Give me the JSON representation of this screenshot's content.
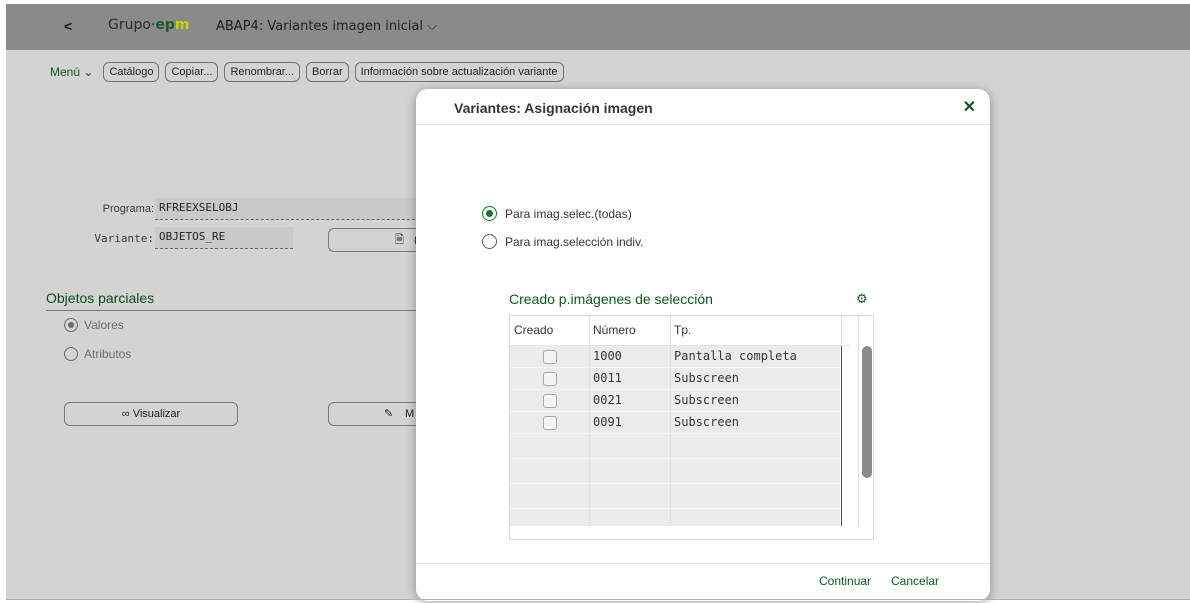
{
  "shell": {
    "back_icon": "chevron-left-icon",
    "logo_prefix": "Grupo·",
    "logo_brand_e": "ep",
    "logo_brand_m": "m",
    "title": "ABAP4: Variantes imagen inicial",
    "title_chevron": "chevron-down-icon"
  },
  "toolbar": {
    "menu": "Menú",
    "buttons": [
      "Catálogo",
      "Copiar...",
      "Renombrar...",
      "Borrar",
      "Información sobre actualización variante"
    ]
  },
  "form": {
    "programa_label": "Programa:",
    "programa_value": "RFREEXSELOBJ",
    "variante_label": "Variante:",
    "variante_value": "OBJETOS_RE",
    "copy_btn_fragment": "(",
    "section_title": "Objetos parciales",
    "radio_valores": "Valores",
    "radio_atributos": "Atributos",
    "visualizar_label": "Visualizar",
    "modificar_fragment": "M"
  },
  "dialog": {
    "title": "Variantes: Asignación imagen",
    "close_icon": "close-icon",
    "option_all": "Para imag.selec.(todas)",
    "option_single": "Para imag.selección indiv.",
    "table_title": "Creado p.imágenes de selección",
    "settings_icon": "settings-gear-icon",
    "columns": [
      "Creado",
      "Número",
      "Tp."
    ],
    "rows": [
      {
        "numero": "1000",
        "tp": "Pantalla completa"
      },
      {
        "numero": "0011",
        "tp": "Subscreen"
      },
      {
        "numero": "0021",
        "tp": "Subscreen"
      },
      {
        "numero": "0091",
        "tp": "Subscreen"
      }
    ],
    "continue_label": "Continuar",
    "cancel_label": "Cancelar"
  },
  "colors": {
    "accent": "#0a5a1e",
    "radio_selected": "#0e7a2f",
    "shell_bg": "#8a8a8a",
    "overlay_bg": "#d3d3d3"
  }
}
